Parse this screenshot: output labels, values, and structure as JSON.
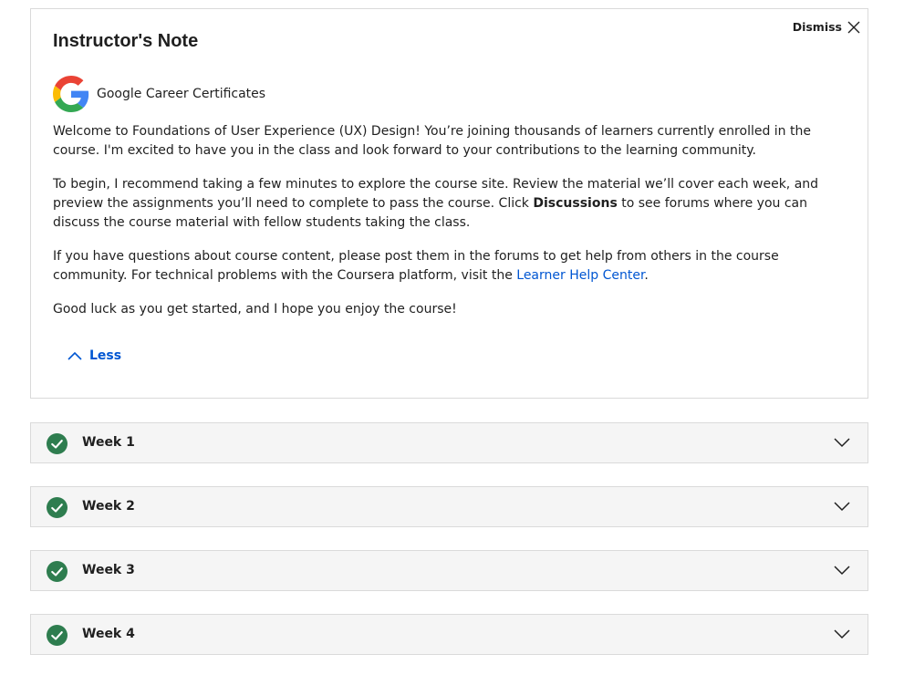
{
  "note": {
    "title": "Instructor's Note",
    "dismiss_label": "Dismiss",
    "partner_name": "Google Career Certificates",
    "paragraphs": {
      "p1": "Welcome to Foundations of User Experience (UX) Design! You’re joining thousands of learners currently enrolled in the course. I'm excited to have you in the class and look forward to your contributions to the learning community.",
      "p2_before": "To begin, I recommend taking a few minutes to explore the course site. Review the material we’ll cover each week, and preview the assignments you’ll need to complete to pass the course. Click ",
      "p2_bold": "Discussions",
      "p2_after": " to see forums where you can discuss the course material with fellow students taking the class.",
      "p3_before": "If you have questions about course content, please post them in the forums to get help from others in the course community. For technical problems with the Coursera platform, visit the ",
      "p3_link": "Learner Help Center",
      "p3_after": ".",
      "p4": "Good luck as you get started, and I hope you enjoy the course!"
    },
    "less_label": "Less"
  },
  "weeks": [
    {
      "label": "Week 1",
      "completed": true
    },
    {
      "label": "Week 2",
      "completed": true
    },
    {
      "label": "Week 3",
      "completed": true
    },
    {
      "label": "Week 4",
      "completed": true
    }
  ],
  "colors": {
    "accent": "#0056d2",
    "check_green": "#2e7d4f",
    "week_bg": "#f5f5f5",
    "border": "#dadada"
  }
}
